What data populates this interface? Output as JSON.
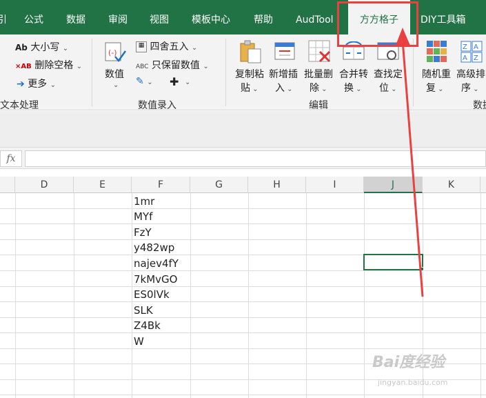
{
  "tabs": [
    {
      "label": "引",
      "active": false
    },
    {
      "label": "公式",
      "active": false
    },
    {
      "label": "数据",
      "active": false
    },
    {
      "label": "审阅",
      "active": false
    },
    {
      "label": "视图",
      "active": false
    },
    {
      "label": "模板中心",
      "active": false
    },
    {
      "label": "帮助",
      "active": false
    },
    {
      "label": "AudTool",
      "active": false
    },
    {
      "label": "方方格子",
      "active": true
    },
    {
      "label": "DIY工具箱",
      "active": false
    }
  ],
  "ribbon": {
    "text_group": {
      "case": "大小写",
      "remove_spaces": "删除空格",
      "more": "更多",
      "label": "文本处理"
    },
    "number_group": {
      "value": "数值",
      "round": "四舍五入",
      "keep_values": "只保留数值",
      "label": "数值录入"
    },
    "edit_group": {
      "copy_paste": [
        "复制粘",
        "贴"
      ],
      "insert": [
        "新增插",
        "入"
      ],
      "batch_delete": [
        "批量删",
        "除"
      ],
      "merge": [
        "合并转",
        "换"
      ],
      "find": [
        "查找定",
        "位"
      ],
      "label": "编辑"
    },
    "data_group": {
      "random": [
        "随机重",
        "复"
      ],
      "sort": [
        "高级排",
        "序"
      ],
      "label": "数据"
    }
  },
  "formula_bar": {
    "fx": "fx",
    "value": ""
  },
  "columns": [
    "D",
    "E",
    "F",
    "G",
    "H",
    "I",
    "J",
    "K"
  ],
  "selected_column": "J",
  "cells_F": [
    "1mr",
    "MYf",
    "FzY",
    "y482wp",
    "najev4fY",
    "7kMvGO",
    "ES0lVk",
    "SLK",
    "Z4Bk",
    "W"
  ],
  "watermark": {
    "brand": "Bai度经验",
    "url": "jingyan.baidu.com"
  },
  "colors": {
    "accent": "#217346",
    "highlight": "#e8413f"
  }
}
